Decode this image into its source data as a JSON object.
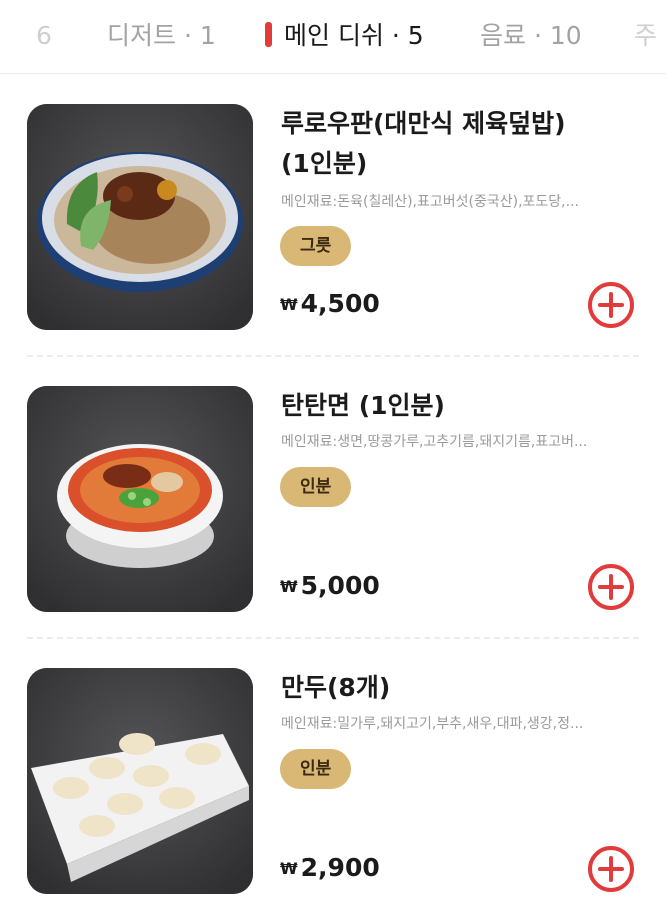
{
  "tabs": [
    {
      "label": "6"
    },
    {
      "label": "디저트 · 1"
    },
    {
      "label": "메인 디쉬 · 5",
      "active": true
    },
    {
      "label": "음료 · 10"
    },
    {
      "label": "주"
    }
  ],
  "menu": [
    {
      "name": "루로우판(대만식 제육덮밥)(1인분)",
      "ingredients": "메인재료:돈육(칠레산),표고버섯(중국산),포도당,...",
      "badge": "그릇",
      "currency": "₩",
      "price": "4,500"
    },
    {
      "name": "탄탄면 (1인분)",
      "ingredients": "메인재료:생면,땅콩가루,고추기름,돼지기름,표고버...",
      "badge": "인분",
      "currency": "₩",
      "price": "5,000"
    },
    {
      "name": "만두(8개)",
      "ingredients": "메인재료:밀가루,돼지고기,부추,새우,대파,생강,정...",
      "badge": "인분",
      "currency": "₩",
      "price": "2,900"
    }
  ],
  "colors": {
    "accent": "#e23b3b",
    "badge": "#d9b775"
  },
  "icons": {
    "add": "plus-circle-icon"
  }
}
